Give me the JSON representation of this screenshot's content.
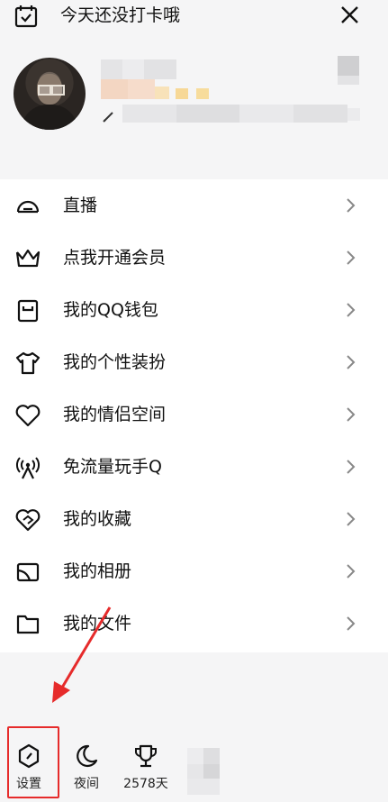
{
  "header": {
    "checkin_text": "今天还没打卡哦"
  },
  "menu": {
    "items": [
      {
        "label": "直播",
        "icon": "live-icon"
      },
      {
        "label": "点我开通会员",
        "icon": "crown-icon"
      },
      {
        "label": "我的QQ钱包",
        "icon": "wallet-icon"
      },
      {
        "label": "我的个性装扮",
        "icon": "shirt-icon"
      },
      {
        "label": "我的情侣空间",
        "icon": "heart-icon"
      },
      {
        "label": "免流量玩手Q",
        "icon": "antenna-icon"
      },
      {
        "label": "我的收藏",
        "icon": "favorite-icon"
      },
      {
        "label": "我的相册",
        "icon": "album-icon"
      },
      {
        "label": "我的文件",
        "icon": "folder-icon"
      }
    ]
  },
  "bottom_bar": {
    "settings_label": "设置",
    "night_label": "夜间",
    "days_label": "2578天"
  },
  "colors": {
    "highlight": "#e62b2b",
    "background": "#f5f5f6",
    "menu_bg": "#ffffff"
  }
}
